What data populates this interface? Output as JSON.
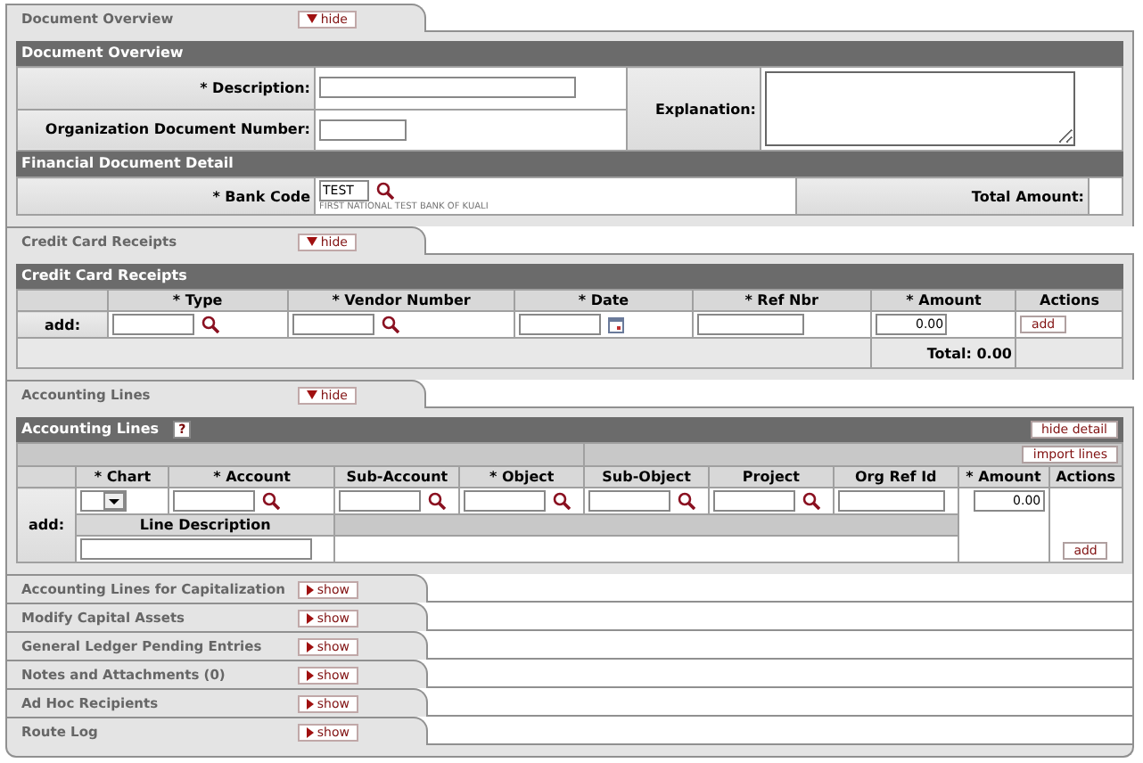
{
  "sections": [
    {
      "kind": "overview",
      "title": "Document Overview",
      "expanded": true,
      "toggle": "hide",
      "heading": "Document Overview",
      "fields": [
        {
          "label": "* Description:",
          "kind": "wide"
        },
        {
          "label": "Organization Document Number:",
          "kind": "short"
        }
      ],
      "explanation_label": "Explanation:",
      "subheading": "Financial Document Detail",
      "bank": {
        "label": "* Bank Code",
        "value": "TEST",
        "name": "FIRST NATIONAL TEST BANK OF KUALI"
      },
      "total_label": "Total Amount:"
    },
    {
      "kind": "receipts",
      "title": "Credit Card Receipts",
      "expanded": true,
      "toggle": "hide",
      "heading": "Credit Card Receipts",
      "columns": [
        "* Type",
        "* Vendor Number",
        "* Date",
        "* Ref Nbr",
        "* Amount",
        "Actions"
      ],
      "add_label": "add:",
      "cells": [
        {
          "kind": "lookup"
        },
        {
          "kind": "lookup"
        },
        {
          "kind": "date"
        },
        {
          "kind": "text"
        },
        {
          "kind": "amount",
          "value": "0.00"
        },
        {
          "kind": "button",
          "label": "add"
        }
      ],
      "total": "Total: 0.00"
    },
    {
      "kind": "accounting",
      "title": "Accounting Lines",
      "expanded": true,
      "toggle": "hide",
      "heading": "Accounting Lines",
      "help": "?",
      "hide_detail": "hide detail",
      "import": "import lines",
      "columns": [
        "* Chart",
        "* Account",
        "Sub-Account",
        "* Object",
        "Sub-Object",
        "Project",
        "Org Ref Id",
        "* Amount",
        "Actions"
      ],
      "add_label": "add:",
      "cells": [
        {
          "kind": "select"
        },
        {
          "kind": "lookup"
        },
        {
          "kind": "lookup"
        },
        {
          "kind": "lookup"
        },
        {
          "kind": "lookup"
        },
        {
          "kind": "lookup"
        },
        {
          "kind": "text"
        },
        {
          "kind": "amount",
          "value": "0.00"
        },
        {
          "kind": "button",
          "label": "add"
        }
      ],
      "line_description": "Line Description"
    },
    {
      "title": "Accounting Lines for Capitalization",
      "expanded": false,
      "toggle": "show"
    },
    {
      "title": "Modify Capital Assets",
      "expanded": false,
      "toggle": "show"
    },
    {
      "title": "General Ledger Pending Entries",
      "expanded": false,
      "toggle": "show"
    },
    {
      "title": "Notes and Attachments (0)",
      "expanded": false,
      "toggle": "show"
    },
    {
      "title": "Ad Hoc Recipients",
      "expanded": false,
      "toggle": "show"
    },
    {
      "title": "Route Log",
      "expanded": false,
      "toggle": "show"
    }
  ]
}
